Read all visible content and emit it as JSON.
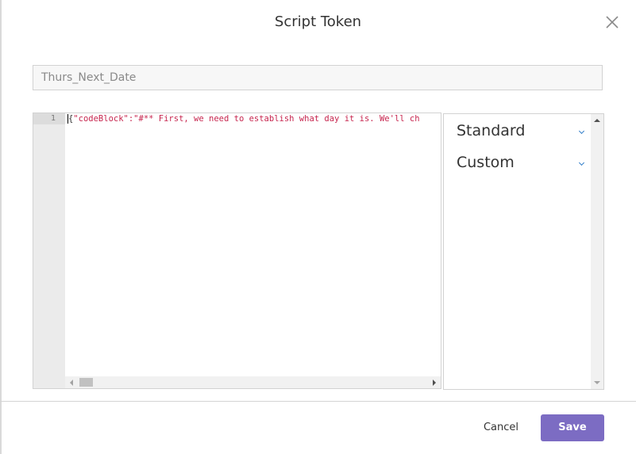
{
  "dialog": {
    "title": "Script Token",
    "close_icon": "close-icon"
  },
  "token_name": {
    "value": "Thurs_Next_Date"
  },
  "editor": {
    "line_number": "1",
    "brace": "{",
    "code": "\"codeBlock\":\"#** First, we need to establish what day it is. We'll ch"
  },
  "side_panel": {
    "items": [
      {
        "label": "Standard",
        "icon": "chevron-down-icon"
      },
      {
        "label": "Custom",
        "icon": "chevron-down-icon"
      }
    ]
  },
  "footer": {
    "cancel_label": "Cancel",
    "save_label": "Save"
  },
  "colors": {
    "accent": "#7c6cc3",
    "code_string": "#c7254e",
    "chevron": "#2f7cc9"
  }
}
